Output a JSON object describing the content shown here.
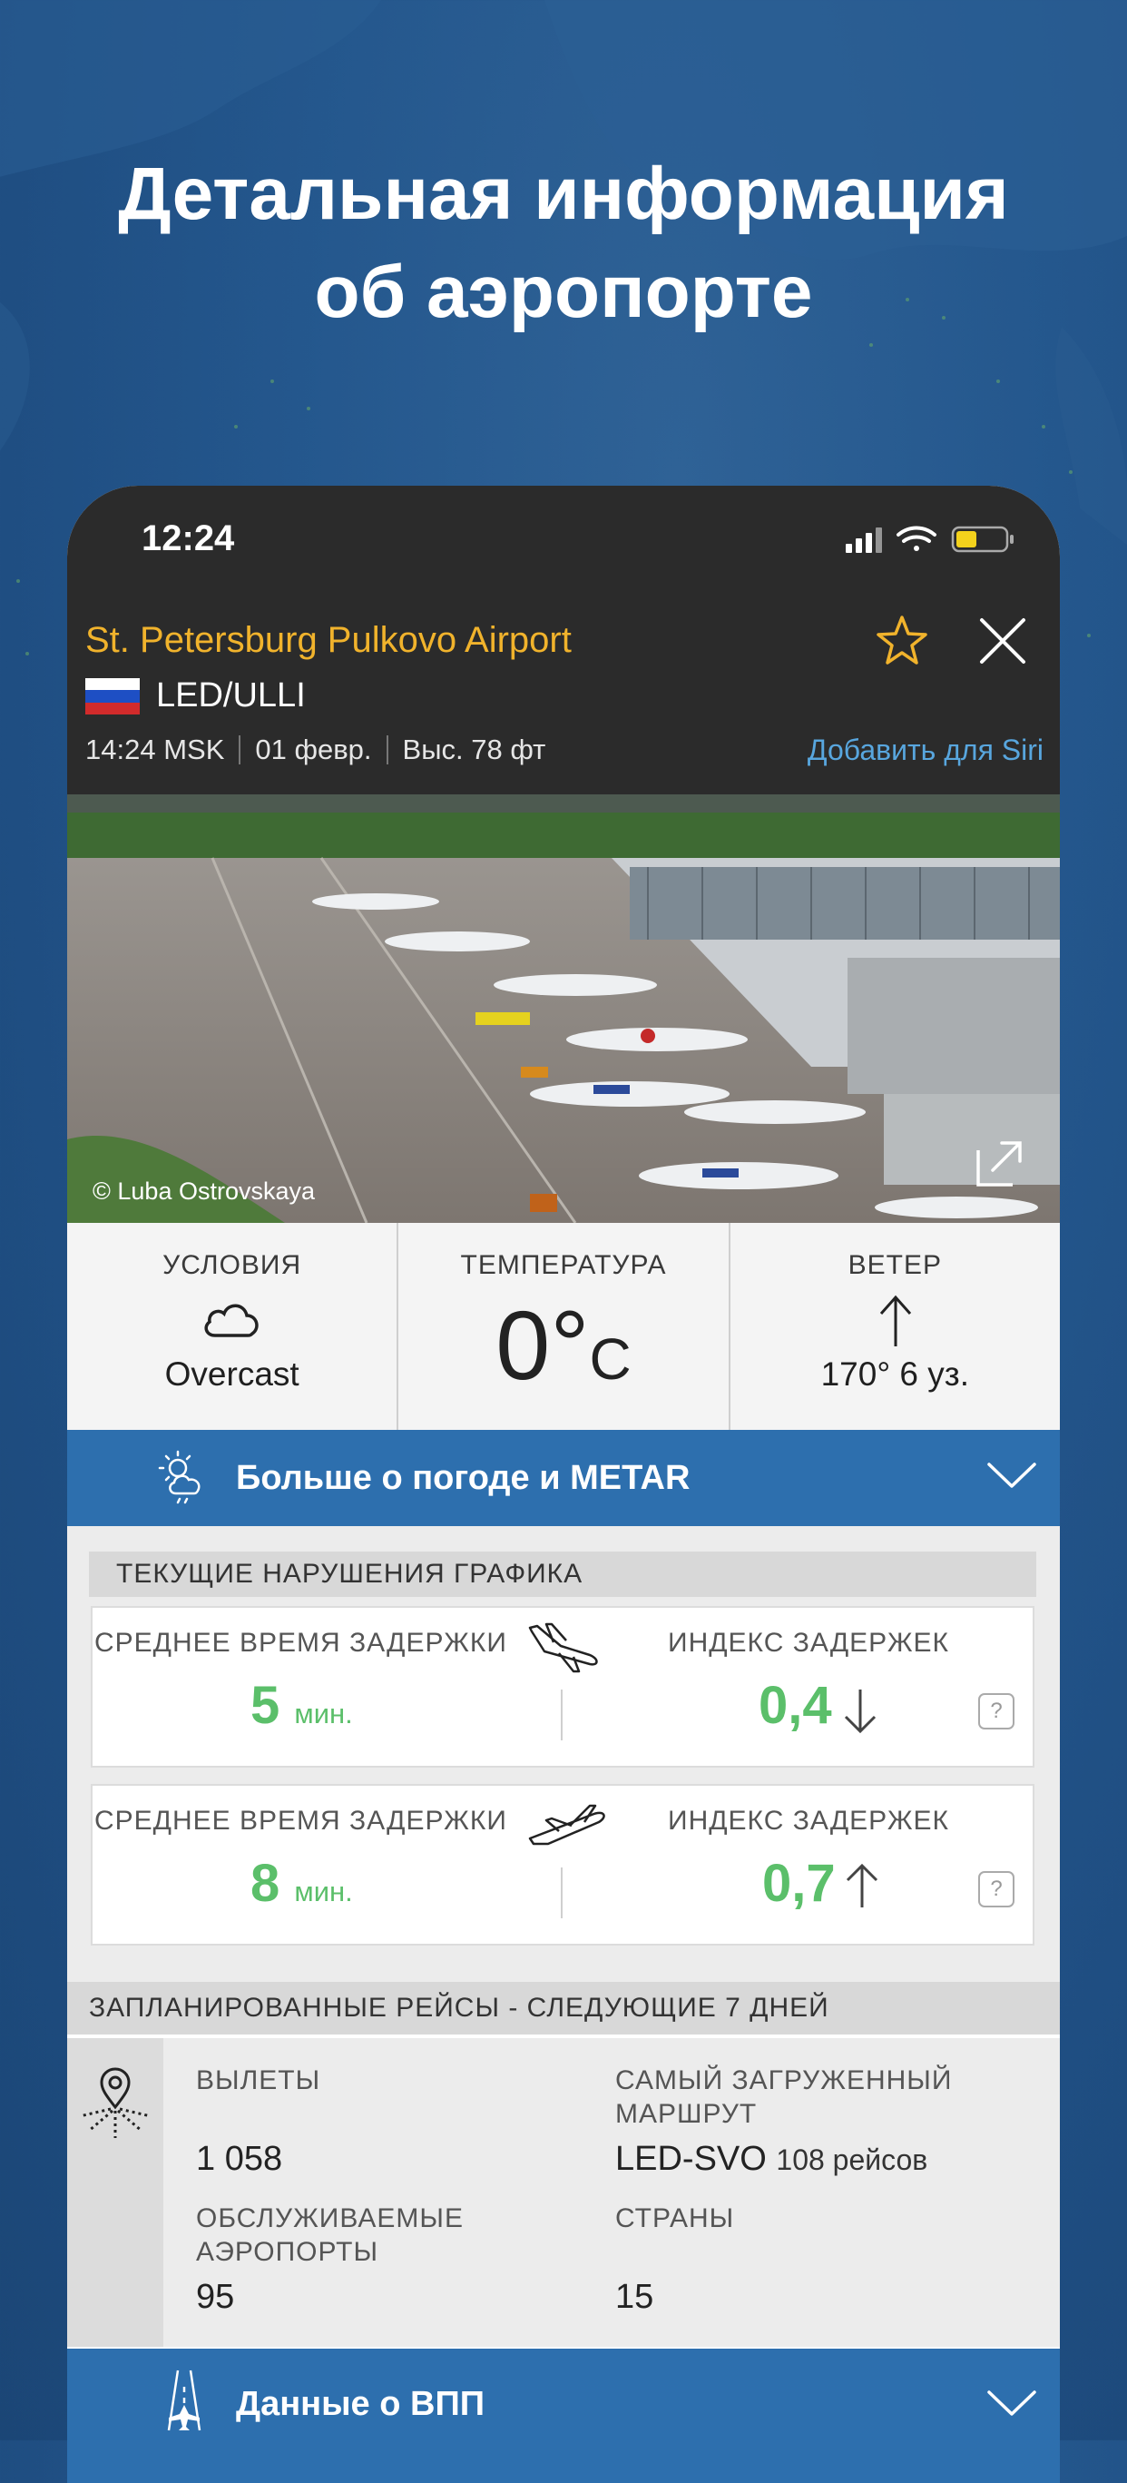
{
  "headline": {
    "line1": "Детальная информация",
    "line2": "об аэропорте"
  },
  "status_bar": {
    "time": "12:24"
  },
  "airport": {
    "name": "St. Petersburg Pulkovo Airport",
    "codes": "LED/ULLI",
    "local_time": "14:24 MSK",
    "date": "01 февр.",
    "elevation": "Выс. 78 фт",
    "siri_link": "Добавить для Siri",
    "photo_credit": "© Luba Ostrovskaya"
  },
  "weather": {
    "conditions_label": "УСЛОВИЯ",
    "conditions_value": "Overcast",
    "temperature_label": "ТЕМПЕРАТУРА",
    "temperature_value": "0°",
    "temperature_unit": "C",
    "wind_label": "ВЕТЕР",
    "wind_value": "170° 6 уз."
  },
  "metar_bar": {
    "label": "Больше о погоде и METAR"
  },
  "disruptions": {
    "header": "ТЕКУЩИЕ НАРУШЕНИЯ ГРАФИКА",
    "arrivals": {
      "delay_label": "СРЕДНЕЕ ВРЕМЯ ЗАДЕРЖКИ",
      "delay_value": "5",
      "delay_unit": "мин.",
      "index_label": "ИНДЕКС ЗАДЕРЖЕК",
      "index_value": "0,4",
      "trend": "down"
    },
    "departures": {
      "delay_label": "СРЕДНЕЕ ВРЕМЯ ЗАДЕРЖКИ",
      "delay_value": "8",
      "delay_unit": "мин.",
      "index_label": "ИНДЕКС ЗАДЕРЖЕК",
      "index_value": "0,7",
      "trend": "up"
    },
    "help_glyph": "?"
  },
  "scheduled": {
    "header": "ЗАПЛАНИРОВАННЫЕ РЕЙСЫ - СЛЕДУЮЩИЕ 7 ДНЕЙ",
    "departures_label": "ВЫЛЕТЫ",
    "departures_value": "1 058",
    "busiest_label_1": "САМЫЙ ЗАГРУЖЕННЫЙ",
    "busiest_label_2": "МАРШРУТ",
    "busiest_route": "LED-SVO",
    "busiest_count": "108 рейсов",
    "airports_label_1": "ОБСЛУЖИВАЕМЫЕ",
    "airports_label_2": "АЭРОПОРТЫ",
    "airports_value": "95",
    "countries_label": "СТРАНЫ",
    "countries_value": "15"
  },
  "runway_bar": {
    "label": "Данные о ВПП"
  },
  "colors": {
    "accent_blue": "#2d6fae",
    "airport_name": "#f1b32c",
    "link": "#58a6de",
    "good_green": "#5bbf6a"
  }
}
